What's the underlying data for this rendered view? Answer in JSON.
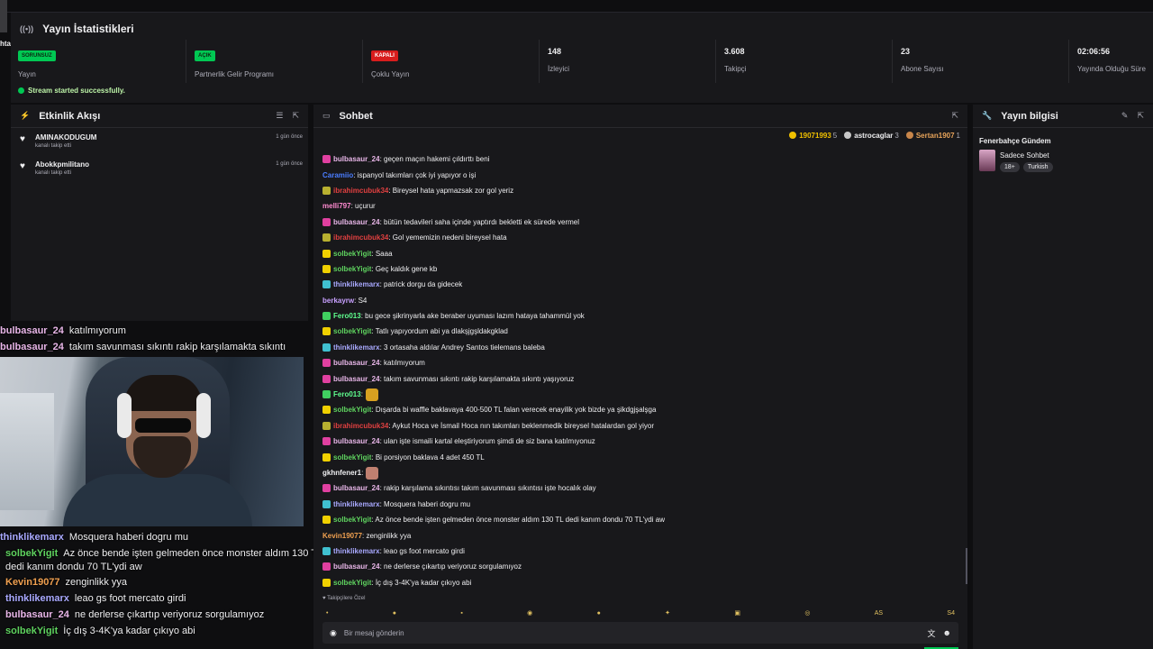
{
  "edge_text": "hta",
  "stats": {
    "title": "Yayın İstatistikleri",
    "items": [
      {
        "badge": "SORUNSUZ",
        "badge_color": "#00c853",
        "label": "Yayın"
      },
      {
        "badge": "AÇIK",
        "badge_color": "#00c853",
        "label": "Partnerlik Gelir Programı"
      },
      {
        "badge": "KAPALI",
        "badge_color": "#d81d1d",
        "label": "Çoklu Yayın"
      },
      {
        "value": "148",
        "label": "İzleyici"
      },
      {
        "value": "3.608",
        "label": "Takipçi"
      },
      {
        "value": "23",
        "label": "Abone Sayısı"
      },
      {
        "value": "02:06:56",
        "label": "Yayında Olduğu Süre"
      }
    ],
    "success_message": "Stream started successfully."
  },
  "activity": {
    "title": "Etkinlik Akışı",
    "items": [
      {
        "name": "AMINAKODUGUM",
        "sub": "kanalı takip etti",
        "time": "1 gün önce"
      },
      {
        "name": "Abokkpmilitano",
        "sub": "kanalı takip etti",
        "time": "1 gün önce"
      }
    ]
  },
  "overlay_chat_top": [
    {
      "user": "bulbasaur_24",
      "text": "katılmıyorum",
      "color": "#e8b6e8"
    },
    {
      "user": "bulbasaur_24",
      "text": "takım savunması sıkıntı rakip karşılamakta sıkıntı",
      "color": "#e8b6e8"
    }
  ],
  "overlay_chat_bottom": [
    {
      "user": "thinklikemarx",
      "text": "Mosquera haberi dogru mu",
      "color": "#a9a9ff"
    },
    {
      "user": "solbekYigit",
      "text": "Az önce bende işten gelmeden önce monster aldım 130 TL",
      "color": "#5fd35f"
    },
    {
      "user": "",
      "text": "dedi kanım dondu 70 TL'ydi aw",
      "color": "#efeff1"
    },
    {
      "user": "Kevin19077",
      "text": "zenginlikk yya",
      "color": "#f0a050"
    },
    {
      "user": "thinklikemarx",
      "text": "leao gs foot mercato girdi",
      "color": "#a9a9ff"
    },
    {
      "user": "bulbasaur_24",
      "text": "ne derlerse çıkartıp veriyoruz sorgulamıyoz",
      "color": "#e8b6e8"
    },
    {
      "user": "solbekYigit",
      "text": "İç dış 3-4K'ya kadar çıkıyo abi",
      "color": "#5fd35f"
    }
  ],
  "chat": {
    "title": "Sohbet",
    "top_supporters": [
      {
        "name": "19071993",
        "count": "5",
        "medal": "#f0c000"
      },
      {
        "name": "astrocaglar",
        "count": "3",
        "medal": "#c8c8c8"
      },
      {
        "name": "Sertan1907",
        "count": "1",
        "medal": "#c8864a"
      }
    ],
    "messages": [
      {
        "user": "bulbasaur_24",
        "text": ": geçen maçın hakemi çıldırttı beni",
        "color": "#e8b6e8",
        "badge": "#e040a0"
      },
      {
        "user": "Caramiio",
        "text": ": ispanyol takımları çok iyi yapıyor o işi",
        "color": "#4a7dff",
        "badge": ""
      },
      {
        "user": "ibrahimcubuk34",
        "text": ": Bireysel hata yapmazsak zor gol yeriz",
        "color": "#e04040",
        "badge": "#b8b030"
      },
      {
        "user": "melli797",
        "text": ": uçurur",
        "color": "#ff8ad0",
        "badge": ""
      },
      {
        "user": "bulbasaur_24",
        "text": ": bütün tedavileri saha içinde yaptırdı bekletti ek sürede vermel",
        "color": "#e8b6e8",
        "badge": "#e040a0"
      },
      {
        "user": "ibrahimcubuk34",
        "text": ": Gol yememizin nedeni bireysel hata",
        "color": "#e04040",
        "badge": "#b8b030"
      },
      {
        "user": "solbekYigit",
        "text": ": Saaa",
        "color": "#5fd35f",
        "badge": "#f0d000"
      },
      {
        "user": "solbekYigit",
        "text": ": Geç kaldık gene kb",
        "color": "#5fd35f",
        "badge": "#f0d000"
      },
      {
        "user": "thinklikemarx",
        "text": ": patrick dorgu da gidecek",
        "color": "#a9a9ff",
        "badge": "#40c0d0"
      },
      {
        "user": "berkayrw",
        "text": ": S4",
        "color": "#c8a0ff",
        "badge": ""
      },
      {
        "user": "Fero013",
        "text": ": bu gece şikrinyarla ake beraber uyuması lazım hataya tahammül yok",
        "color": "#5fff8f",
        "badge": "#40d060"
      },
      {
        "user": "solbekYigit",
        "text": ": Tatlı yapıyordum abi ya dlakşjgşldakgklad",
        "color": "#5fd35f",
        "badge": "#f0d000"
      },
      {
        "user": "thinklikemarx",
        "text": ": 3 ortasaha aldılar Andrey Santos tielemans baleba",
        "color": "#a9a9ff",
        "badge": "#40c0d0"
      },
      {
        "user": "bulbasaur_24",
        "text": ": katılmıyorum",
        "color": "#e8b6e8",
        "badge": "#e040a0"
      },
      {
        "user": "bulbasaur_24",
        "text": ": takım savunması sıkıntı rakip karşılamakta sıkıntı yaşıyoruz",
        "color": "#e8b6e8",
        "badge": "#e040a0"
      },
      {
        "user": "Fero013",
        "text": ":",
        "color": "#5fff8f",
        "badge": "#40d060",
        "emote": "#d8a020"
      },
      {
        "user": "solbekYigit",
        "text": ": Dışarda bi waffle baklavaya 400-500 TL falan verecek enayilik yok bizde ya şikdgjşalşga",
        "color": "#5fd35f",
        "badge": "#f0d000"
      },
      {
        "user": "ibrahimcubuk34",
        "text": ": Aykut Hoca ve İsmail Hoca nın takımları beklenmedik bireysel hatalardan gol yiyor",
        "color": "#e04040",
        "badge": "#b8b030"
      },
      {
        "user": "bulbasaur_24",
        "text": ": ulan işte ismaili kartal eleştiriyorum şimdi de siz bana katılmıyonuz",
        "color": "#e8b6e8",
        "badge": "#e040a0"
      },
      {
        "user": "solbekYigit",
        "text": ": Bi porsiyon baklava 4 adet 450 TL",
        "color": "#5fd35f",
        "badge": "#f0d000"
      },
      {
        "user": "gkhnfener1",
        "text": ":",
        "color": "#efeff1",
        "badge": "",
        "emote": "#c08070"
      },
      {
        "user": "bulbasaur_24",
        "text": ": rakip karşılama sıkıntısı takım savunması sıkıntısı işte hocalık olay",
        "color": "#e8b6e8",
        "badge": "#e040a0"
      },
      {
        "user": "thinklikemarx",
        "text": ": Mosquera haberi dogru mu",
        "color": "#a9a9ff",
        "badge": "#40c0d0"
      },
      {
        "user": "solbekYigit",
        "text": ": Az önce bende işten gelmeden önce monster aldım 130 TL dedi kanım dondu 70 TL'ydi aw",
        "color": "#5fd35f",
        "badge": "#f0d000"
      },
      {
        "user": "Kevin19077",
        "text": ": zenginlikk yya",
        "color": "#f0a050",
        "badge": ""
      },
      {
        "user": "thinklikemarx",
        "text": ": leao gs foot mercato girdi",
        "color": "#a9a9ff",
        "badge": "#40c0d0"
      },
      {
        "user": "bulbasaur_24",
        "text": ": ne derlerse çıkartıp veriyoruz sorgulamıyoz",
        "color": "#e8b6e8",
        "badge": "#e040a0"
      },
      {
        "user": "solbekYigit",
        "text": ": İç dış 3-4K'ya kadar çıkıyo abi",
        "color": "#5fd35f",
        "badge": "#f0d000"
      }
    ],
    "follower_note": "Takipçilere Özel",
    "emote_bar": [
      "AS",
      "S4"
    ],
    "input_placeholder": "Bir mesaj gönderin"
  },
  "info": {
    "title": "Yayın bilgisi",
    "category": "Fenerbahçe Gündem",
    "stream_title": "Sadece Sohbet",
    "tags": [
      "18+",
      "Turkish"
    ]
  }
}
